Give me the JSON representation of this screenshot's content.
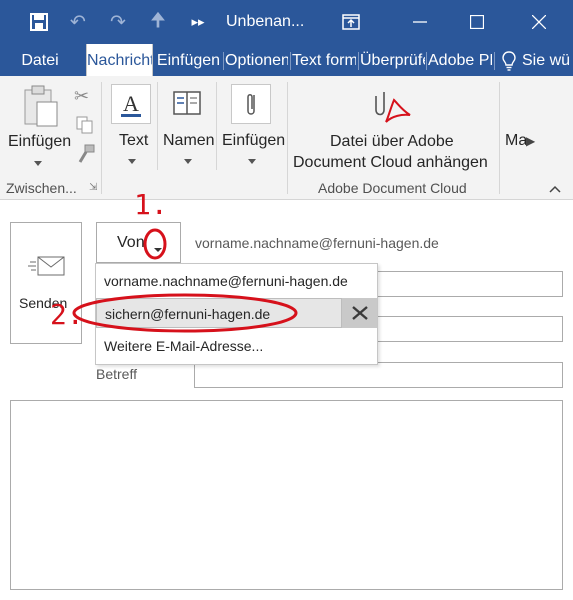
{
  "titlebar": {
    "title": "Unbenan...",
    "icons": [
      "save-icon",
      "undo-icon",
      "redo-icon",
      "up-arrow-icon",
      "customize-quick-access-icon",
      "restore-window-icon",
      "minimize-icon",
      "maximize-icon",
      "close-icon"
    ]
  },
  "tabs": [
    {
      "label": "Datei"
    },
    {
      "label": "Nachricht"
    },
    {
      "label": "Einfügen"
    },
    {
      "label": "Optionen"
    },
    {
      "label": "Text formatieren"
    },
    {
      "label": "Überprüfen"
    },
    {
      "label": "Adobe PDF"
    }
  ],
  "tell_me": "Sie wü",
  "ribbon": {
    "paste_label": "Einfügen",
    "clipboard_group": "Zwischen...",
    "text_label": "Text",
    "names_label": "Namen",
    "insert_label": "Einfügen",
    "adobe_line1": "Datei über Adobe",
    "adobe_line2": "Document Cloud anhängen",
    "adobe_group": "Adobe Document Cloud",
    "more_label": "Ma"
  },
  "compose": {
    "send_label": "Senden",
    "from_label": "Von",
    "from_value": "vorname.nachname@fernuni-hagen.de",
    "subject_label": "Betreff"
  },
  "dropdown": {
    "items": [
      "vorname.nachname@fernuni-hagen.de",
      "sichern@fernuni-hagen.de",
      "Weitere E-Mail-Adresse..."
    ],
    "selected": 1
  },
  "annotations": {
    "step1": "1.",
    "step2": "2."
  },
  "colors": {
    "titlebar": "#2b579a",
    "ribbon": "#f3f3f3",
    "annotation": "#d6111b"
  }
}
